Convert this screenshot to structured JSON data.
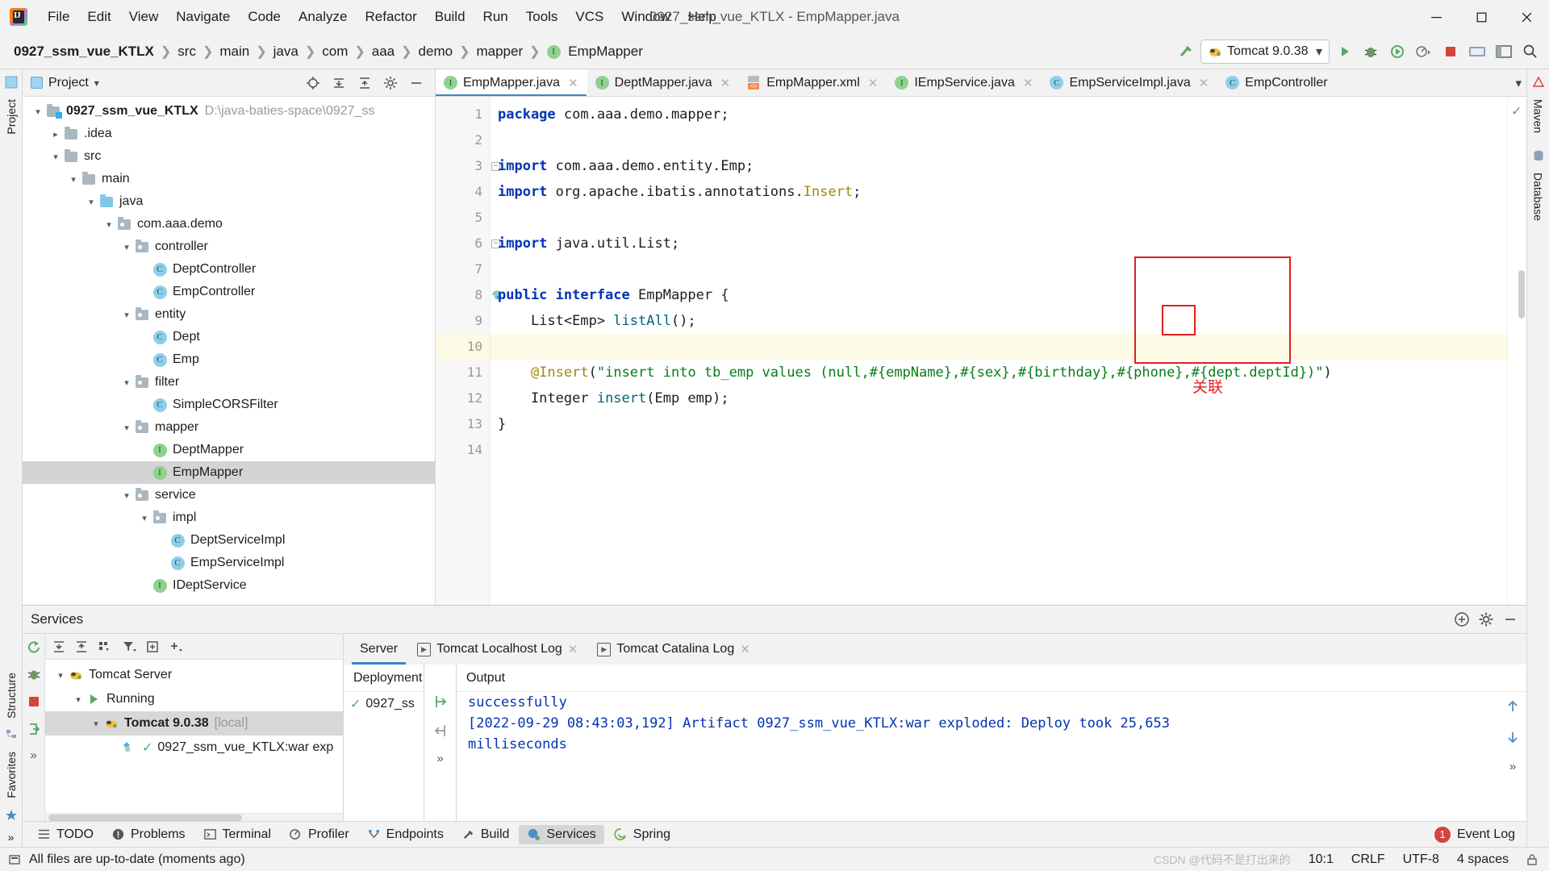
{
  "window": {
    "title": "0927_ssm_vue_KTLX - EmpMapper.java",
    "minimize": "─",
    "maximize": "☐",
    "close": "✕"
  },
  "menubar": {
    "items": [
      "File",
      "Edit",
      "View",
      "Navigate",
      "Code",
      "Analyze",
      "Refactor",
      "Build",
      "Run",
      "Tools",
      "VCS",
      "Window",
      "Help"
    ]
  },
  "breadcrumbs": {
    "items": [
      {
        "label": "0927_ssm_vue_KTLX",
        "bold": true,
        "icon": ""
      },
      {
        "label": "src",
        "bold": false,
        "icon": ""
      },
      {
        "label": "main",
        "bold": false,
        "icon": ""
      },
      {
        "label": "java",
        "bold": false,
        "icon": ""
      },
      {
        "label": "com",
        "bold": false,
        "icon": ""
      },
      {
        "label": "aaa",
        "bold": false,
        "icon": ""
      },
      {
        "label": "demo",
        "bold": false,
        "icon": ""
      },
      {
        "label": "mapper",
        "bold": false,
        "icon": ""
      },
      {
        "label": "EmpMapper",
        "bold": false,
        "icon": "interface-badge"
      }
    ],
    "separator": "❯"
  },
  "toolbar": {
    "run_config": "Tomcat 9.0.38",
    "run_config_icon": "tomcat-icon",
    "dropdown_caret": "▾",
    "build_icon": "hammer-icon",
    "run_icon": "run-icon",
    "debug_icon": "debug-icon",
    "run_coverage_icon": "coverage-icon",
    "profile_icon": "profile-icon",
    "stop_icon": "stop-icon",
    "updates_icon": "updates-icon",
    "layout_icon": "layout-icon",
    "search_icon": "search-icon"
  },
  "project_panel": {
    "title": "Project",
    "caret": "▾",
    "actions": [
      "locate-icon",
      "expand-all-icon",
      "collapse-all-icon",
      "gear-icon",
      "hide-icon"
    ],
    "tree": [
      {
        "depth": 0,
        "arrow": "⌄",
        "icon": "module-folder",
        "label": "0927_ssm_vue_KTLX",
        "bold": true,
        "path": "D:\\java-baties-space\\0927_ss",
        "selected": false
      },
      {
        "depth": 1,
        "arrow": "›",
        "icon": "folder",
        "label": ".idea",
        "bold": false,
        "path": "",
        "selected": false
      },
      {
        "depth": 1,
        "arrow": "⌄",
        "icon": "folder",
        "label": "src",
        "bold": false,
        "path": "",
        "selected": false
      },
      {
        "depth": 2,
        "arrow": "⌄",
        "icon": "folder",
        "label": "main",
        "bold": false,
        "path": "",
        "selected": false
      },
      {
        "depth": 3,
        "arrow": "⌄",
        "icon": "folder-blue",
        "label": "java",
        "bold": false,
        "path": "",
        "selected": false
      },
      {
        "depth": 4,
        "arrow": "⌄",
        "icon": "package",
        "label": "com.aaa.demo",
        "bold": false,
        "path": "",
        "selected": false
      },
      {
        "depth": 5,
        "arrow": "⌄",
        "icon": "package",
        "label": "controller",
        "bold": false,
        "path": "",
        "selected": false
      },
      {
        "depth": 6,
        "arrow": "",
        "icon": "class-badge",
        "label": "DeptController",
        "bold": false,
        "path": "",
        "selected": false
      },
      {
        "depth": 6,
        "arrow": "",
        "icon": "class-badge",
        "label": "EmpController",
        "bold": false,
        "path": "",
        "selected": false
      },
      {
        "depth": 5,
        "arrow": "⌄",
        "icon": "package",
        "label": "entity",
        "bold": false,
        "path": "",
        "selected": false
      },
      {
        "depth": 6,
        "arrow": "",
        "icon": "class-badge",
        "label": "Dept",
        "bold": false,
        "path": "",
        "selected": false
      },
      {
        "depth": 6,
        "arrow": "",
        "icon": "class-badge",
        "label": "Emp",
        "bold": false,
        "path": "",
        "selected": false
      },
      {
        "depth": 5,
        "arrow": "⌄",
        "icon": "package",
        "label": "filter",
        "bold": false,
        "path": "",
        "selected": false
      },
      {
        "depth": 6,
        "arrow": "",
        "icon": "class-badge",
        "label": "SimpleCORSFilter",
        "bold": false,
        "path": "",
        "selected": false
      },
      {
        "depth": 5,
        "arrow": "⌄",
        "icon": "package",
        "label": "mapper",
        "bold": false,
        "path": "",
        "selected": false
      },
      {
        "depth": 6,
        "arrow": "",
        "icon": "interface-badge",
        "label": "DeptMapper",
        "bold": false,
        "path": "",
        "selected": false
      },
      {
        "depth": 6,
        "arrow": "",
        "icon": "interface-badge",
        "label": "EmpMapper",
        "bold": false,
        "path": "",
        "selected": true
      },
      {
        "depth": 5,
        "arrow": "⌄",
        "icon": "package",
        "label": "service",
        "bold": false,
        "path": "",
        "selected": false
      },
      {
        "depth": 6,
        "arrow": "⌄",
        "icon": "package",
        "label": "impl",
        "bold": false,
        "path": "",
        "selected": false
      },
      {
        "depth": 7,
        "arrow": "",
        "icon": "class-badge",
        "label": "DeptServiceImpl",
        "bold": false,
        "path": "",
        "selected": false
      },
      {
        "depth": 7,
        "arrow": "",
        "icon": "class-badge",
        "label": "EmpServiceImpl",
        "bold": false,
        "path": "",
        "selected": false
      },
      {
        "depth": 6,
        "arrow": "",
        "icon": "interface-badge",
        "label": "IDeptService",
        "bold": false,
        "path": "",
        "selected": false
      }
    ]
  },
  "editor_tabs": [
    {
      "label": "EmpMapper.java",
      "icon": "interface-badge",
      "active": true,
      "close": "✕"
    },
    {
      "label": "DeptMapper.java",
      "icon": "interface-badge",
      "active": false,
      "close": "✕"
    },
    {
      "label": "EmpMapper.xml",
      "icon": "xml-file-icon",
      "active": false,
      "close": "✕"
    },
    {
      "label": "IEmpService.java",
      "icon": "interface-badge",
      "active": false,
      "close": "✕"
    },
    {
      "label": "EmpServiceImpl.java",
      "icon": "class-badge",
      "active": false,
      "close": "✕"
    },
    {
      "label": "EmpController",
      "icon": "class-badge",
      "active": false,
      "close": ""
    }
  ],
  "editor_tabs_more": "▾",
  "editor": {
    "line_numbers": [
      "1",
      "2",
      "3",
      "4",
      "5",
      "6",
      "7",
      "8",
      "9",
      "10",
      "11",
      "12",
      "13",
      "14"
    ],
    "current_line": 10,
    "inspection_status": "✓",
    "lines": [
      {
        "n": 1,
        "tokens": [
          {
            "t": "package ",
            "c": "kw"
          },
          {
            "t": "com.aaa.demo.mapper;",
            "c": "plain"
          }
        ]
      },
      {
        "n": 2,
        "tokens": []
      },
      {
        "n": 3,
        "tokens": [
          {
            "t": "import ",
            "c": "kw"
          },
          {
            "t": "com.aaa.demo.entity.Emp;",
            "c": "plain"
          }
        ]
      },
      {
        "n": 4,
        "tokens": [
          {
            "t": "import ",
            "c": "kw"
          },
          {
            "t": "org.apache.ibatis.annotations.",
            "c": "plain"
          },
          {
            "t": "Insert",
            "c": "ann"
          },
          {
            "t": ";",
            "c": "plain"
          }
        ]
      },
      {
        "n": 5,
        "tokens": []
      },
      {
        "n": 6,
        "tokens": [
          {
            "t": "import ",
            "c": "kw"
          },
          {
            "t": "java.util.List;",
            "c": "plain"
          }
        ]
      },
      {
        "n": 7,
        "tokens": []
      },
      {
        "n": 8,
        "tokens": [
          {
            "t": "public interface ",
            "c": "kw"
          },
          {
            "t": "EmpMapper {",
            "c": "plain"
          }
        ]
      },
      {
        "n": 9,
        "tokens": [
          {
            "t": "    List<Emp> ",
            "c": "plain"
          },
          {
            "t": "listAll",
            "c": "meth"
          },
          {
            "t": "();",
            "c": "plain"
          }
        ]
      },
      {
        "n": 10,
        "tokens": []
      },
      {
        "n": 11,
        "tokens": [
          {
            "t": "    ",
            "c": "plain"
          },
          {
            "t": "@Insert",
            "c": "ann"
          },
          {
            "t": "(",
            "c": "plain"
          },
          {
            "t": "\"insert into tb_emp values (null,#{empName},#{sex},#{birthday},#{phone},#{dept.deptId})\"",
            "c": "str"
          },
          {
            "t": ")",
            "c": "plain"
          }
        ]
      },
      {
        "n": 12,
        "tokens": [
          {
            "t": "    Integer ",
            "c": "plain"
          },
          {
            "t": "insert",
            "c": "meth"
          },
          {
            "t": "(Emp emp);",
            "c": "plain"
          }
        ]
      },
      {
        "n": 13,
        "tokens": [
          {
            "t": "}",
            "c": "plain"
          }
        ]
      },
      {
        "n": 14,
        "tokens": []
      }
    ]
  },
  "annotation": {
    "label": "关联",
    "color": "#e02020"
  },
  "services": {
    "title": "Services",
    "header_actions": [
      "add-service-icon",
      "gear-icon",
      "hide-icon"
    ],
    "rail_icons": [
      "rerun-icon",
      "debug-icon",
      "stop-icon",
      "deploy-icon",
      "more-icon"
    ],
    "toolbar_icons": [
      "expand-all-icon",
      "collapse-all-icon",
      "group-icon",
      "filter-icon",
      "add-frame-icon",
      "add-icon"
    ],
    "tree": [
      {
        "depth": 0,
        "arrow": "⌄",
        "icon": "tomcat-icon",
        "label": "Tomcat Server",
        "bold": false,
        "suffix": "",
        "selected": false,
        "check": false
      },
      {
        "depth": 1,
        "arrow": "⌄",
        "icon": "running-icon",
        "label": "Running",
        "bold": false,
        "suffix": "",
        "selected": false,
        "check": false
      },
      {
        "depth": 2,
        "arrow": "⌄",
        "icon": "tomcat-icon",
        "label": "Tomcat 9.0.38",
        "bold": true,
        "suffix": "[local]",
        "selected": true,
        "check": false
      },
      {
        "depth": 3,
        "arrow": "",
        "icon": "artifact-icon",
        "label": "0927_ssm_vue_KTLX:war exp",
        "bold": false,
        "suffix": "",
        "selected": false,
        "check": true
      }
    ],
    "tabs": [
      {
        "label": "Server",
        "icon": "",
        "active": true,
        "close": ""
      },
      {
        "label": "Tomcat Localhost Log",
        "icon": "play-square-icon",
        "active": false,
        "close": "✕"
      },
      {
        "label": "Tomcat Catalina Log",
        "icon": "play-square-icon",
        "active": false,
        "close": "✕"
      }
    ],
    "deployment_header": "Deployment",
    "deployment_item": "0927_ss",
    "deployment_check": "✓",
    "output_header": "Output",
    "output_lines": [
      "successfully",
      "[2022-09-29 08:43:03,192] Artifact 0927_ssm_vue_KTLX:war exploded: Deploy took 25,653",
      "milliseconds"
    ],
    "mini_rail_icons": [
      "deploy-right-icon",
      "deploy-left-icon",
      "more-icon"
    ],
    "out_rail_icons": [
      "scroll-up-icon",
      "scroll-down-icon",
      "more-icon"
    ]
  },
  "left_rail": {
    "items": [
      {
        "label": "Project",
        "icon": "project-icon"
      },
      {
        "label": "Structure",
        "icon": "structure-icon"
      },
      {
        "label": "Favorites",
        "icon": "star-icon"
      }
    ],
    "more": "»"
  },
  "right_rail": {
    "items": [
      {
        "label": "Maven",
        "icon": "maven-icon"
      },
      {
        "label": "Database",
        "icon": "database-icon"
      }
    ]
  },
  "toolwindow_bar": {
    "items": [
      {
        "label": "TODO",
        "icon": "todo-icon",
        "active": false
      },
      {
        "label": "Problems",
        "icon": "problems-icon",
        "active": false
      },
      {
        "label": "Terminal",
        "icon": "terminal-icon",
        "active": false
      },
      {
        "label": "Profiler",
        "icon": "profiler-icon",
        "active": false
      },
      {
        "label": "Endpoints",
        "icon": "endpoints-icon",
        "active": false
      },
      {
        "label": "Build",
        "icon": "build-icon",
        "active": false
      },
      {
        "label": "Services",
        "icon": "services-icon",
        "active": true
      },
      {
        "label": "Spring",
        "icon": "spring-icon",
        "active": false
      }
    ],
    "event_log": "Event Log",
    "event_log_badge": "1"
  },
  "statusbar": {
    "message": "All files are up-to-date (moments ago)",
    "caret_position": "10:1",
    "line_separator": "CRLF",
    "encoding": "UTF-8",
    "indent": "4 spaces",
    "watermark": "CSDN @代码不是打出来的"
  }
}
